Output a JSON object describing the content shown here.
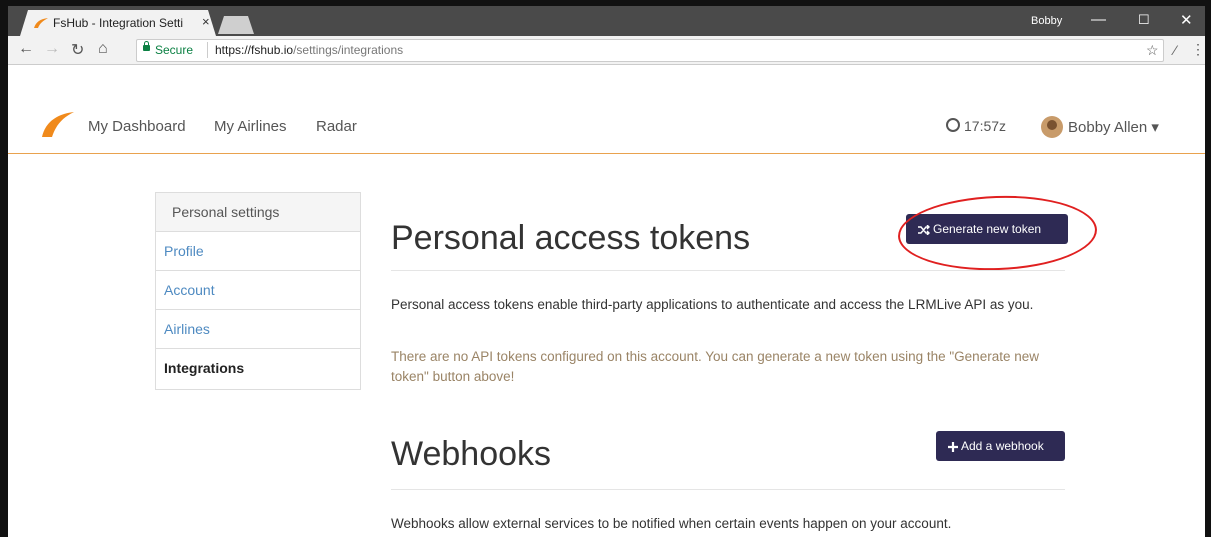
{
  "browser": {
    "tab_title": "FsHub - Integration Setti",
    "tab_close": "×",
    "window_user": "Bobby",
    "win_min": "—",
    "win_max": "☐",
    "win_close": "✕",
    "secure_label": "Secure",
    "url_scheme": "https://",
    "url_host": "fshub.io",
    "url_path": "/settings/integrations"
  },
  "navbar": {
    "links": [
      "My Dashboard",
      "My Airlines",
      "Radar"
    ],
    "clock": "17:57z",
    "user": "Bobby Allen ▾"
  },
  "sidebar": {
    "heading": "Personal settings",
    "items": [
      {
        "label": "Profile"
      },
      {
        "label": "Account"
      },
      {
        "label": "Airlines"
      },
      {
        "label": "Integrations"
      }
    ]
  },
  "tokens": {
    "title": "Personal access tokens",
    "button": "Generate new token",
    "description": "Personal access tokens enable third-party applications to authenticate and access the LRMLive API as you.",
    "empty_message": "There are no API tokens configured on this account. You can generate a new token using the \"Generate new token\" button above!"
  },
  "webhooks": {
    "title": "Webhooks",
    "button": "Add a webhook",
    "description": "Webhooks allow external services to be notified when certain events happen on your account."
  },
  "colors": {
    "accent": "#2e2a54",
    "link": "#4e8ac1",
    "nav_border": "#e9a24e",
    "annotation": "#e02020"
  }
}
